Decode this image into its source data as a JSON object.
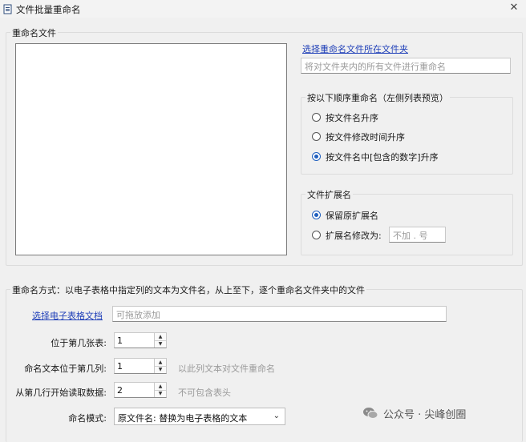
{
  "window": {
    "title": "文件批量重命名",
    "close_glyph": "✕"
  },
  "group_files": {
    "label": "重命名文件",
    "select_folder_link": "选择重命名文件所在文件夹",
    "folder_placeholder": "将对文件夹内的所有文件进行重命名"
  },
  "group_order": {
    "label": "按以下顺序重命名（左侧列表预览）",
    "options": [
      {
        "label": "按文件名升序",
        "checked": false
      },
      {
        "label": "按文件修改时间升序",
        "checked": false
      },
      {
        "label": "按文件名中[包含的数字]升序",
        "checked": true
      }
    ]
  },
  "group_ext": {
    "label": "文件扩展名",
    "options": [
      {
        "label": "保留原扩展名",
        "checked": true
      },
      {
        "label": "扩展名修改为:",
        "checked": false
      }
    ],
    "ext_placeholder": "不加 . 号"
  },
  "group_mode": {
    "label": "重命名方式：以电子表格中指定列的文本为文件名，从上至下，逐个重命名文件夹中的文件",
    "select_sheet_link": "选择电子表格文档",
    "sheet_placeholder": "可拖放添加",
    "sheet_index_label": "位于第几张表:",
    "sheet_index_value": "1",
    "column_label": "命名文本位于第几列:",
    "column_value": "1",
    "column_hint": "以此列文本对文件重命名",
    "start_row_label": "从第几行开始读取数据:",
    "start_row_value": "2",
    "start_row_hint": "不可包含表头",
    "naming_mode_label": "命名模式:",
    "naming_mode_value": "原文件名: 替换为电子表格的文本"
  },
  "watermark": {
    "text": "公众号 · 尖峰创圈"
  }
}
